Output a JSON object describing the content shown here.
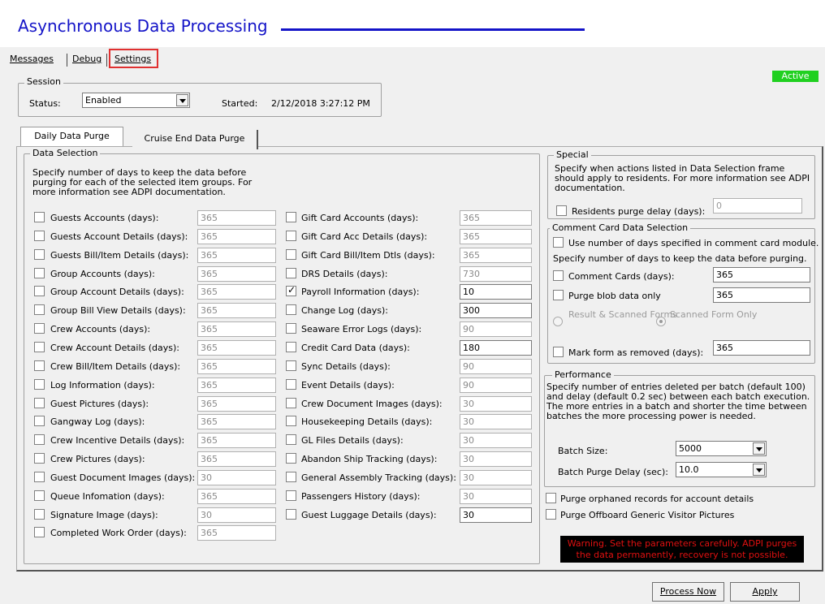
{
  "app": {
    "title": "Asynchronous Data Processing",
    "status_badge": "Active"
  },
  "menu": {
    "messages": "Messages",
    "debug": "Debug",
    "settings": "Settings"
  },
  "session": {
    "label": "Session",
    "status_label": "Status:",
    "status_value": "Enabled",
    "started_label": "Started:",
    "started_value": "2/12/2018 3:27:12 PM"
  },
  "tabs": {
    "daily": "Daily Data Purge",
    "cruise": "Cruise End Data Purge"
  },
  "data_selection": {
    "label": "Data Selection",
    "description": "Specify number of days to keep the data before purging for each of the selected item groups. For more information see ADPI documentation.",
    "col1": [
      {
        "label": "Guests Accounts (days):",
        "value": "365",
        "checked": false
      },
      {
        "label": "Guests Account Details (days):",
        "value": "365",
        "checked": false
      },
      {
        "label": "Guests Bill/Item Details (days):",
        "value": "365",
        "checked": false
      },
      {
        "label": "Group Accounts (days):",
        "value": "365",
        "checked": false
      },
      {
        "label": "Group Account Details (days):",
        "value": "365",
        "checked": false
      },
      {
        "label": "Group Bill View Details (days):",
        "value": "365",
        "checked": false
      },
      {
        "label": "Crew Accounts (days):",
        "value": "365",
        "checked": false
      },
      {
        "label": "Crew Account Details (days):",
        "value": "365",
        "checked": false
      },
      {
        "label": "Crew Bill/Item Details (days):",
        "value": "365",
        "checked": false
      },
      {
        "label": "Log Information (days):",
        "value": "365",
        "checked": false
      },
      {
        "label": "Guest Pictures (days):",
        "value": "365",
        "checked": false
      },
      {
        "label": "Gangway Log (days):",
        "value": "365",
        "checked": false
      },
      {
        "label": "Crew Incentive Details (days):",
        "value": "365",
        "checked": false
      },
      {
        "label": "Crew Pictures (days):",
        "value": "365",
        "checked": false
      },
      {
        "label": "Guest Document Images (days):",
        "value": "30",
        "checked": false
      },
      {
        "label": "Queue Infomation (days):",
        "value": "365",
        "checked": false
      },
      {
        "label": "Signature Image (days):",
        "value": "30",
        "checked": false
      },
      {
        "label": "Completed Work Order (days):",
        "value": "365",
        "checked": false
      }
    ],
    "col2": [
      {
        "label": "Gift Card Accounts (days):",
        "value": "365",
        "checked": false
      },
      {
        "label": "Gift Card Acc Details (days):",
        "value": "365",
        "checked": false
      },
      {
        "label": "Gift Card Bill/Item Dtls (days):",
        "value": "365",
        "checked": false
      },
      {
        "label": "DRS Details (days):",
        "value": "730",
        "checked": false
      },
      {
        "label": "Payroll Information (days):",
        "value": "10",
        "checked": true
      },
      {
        "label": "Change Log (days):",
        "value": "300",
        "checked": false
      },
      {
        "label": "Seaware Error Logs (days):",
        "value": "90",
        "checked": false
      },
      {
        "label": "Credit Card Data (days):",
        "value": "180",
        "checked": false
      },
      {
        "label": "Sync Details (days):",
        "value": "90",
        "checked": false
      },
      {
        "label": "Event Details (days):",
        "value": "90",
        "checked": false
      },
      {
        "label": "Crew Document Images (days):",
        "value": "30",
        "checked": false
      },
      {
        "label": "Housekeeping Details (days):",
        "value": "30",
        "checked": false
      },
      {
        "label": "GL Files Details (days):",
        "value": "30",
        "checked": false
      },
      {
        "label": "Abandon Ship Tracking (days):",
        "value": "30",
        "checked": false
      },
      {
        "label": "General Assembly Tracking (days):",
        "value": "30",
        "checked": false
      },
      {
        "label": "Passengers History (days):",
        "value": "30",
        "checked": false
      },
      {
        "label": "Guest Luggage Details (days):",
        "value": "30",
        "checked": false
      }
    ]
  },
  "special": {
    "label": "Special",
    "description": "Specify when actions listed in Data Selection frame should apply to residents. For more information see ADPI documentation.",
    "residents_label": "Residents purge delay (days):",
    "residents_value": "0"
  },
  "comment_card": {
    "label": "Comment Card Data Selection",
    "use_days_label": "Use number of days specified in comment card module.",
    "specify_label": "Specify number of days to keep the data before purging.",
    "comment_cards_label": "Comment Cards (days):",
    "comment_cards_value": "365",
    "purge_blob_label": "Purge blob data only",
    "purge_blob_value": "365",
    "radio1": "Result & Scanned Forms",
    "radio2": "Scanned Form Only",
    "mark_removed_label": "Mark form as removed (days):",
    "mark_removed_value": "365"
  },
  "performance": {
    "label": "Performance",
    "description": "Specify number of entries deleted per batch (default 100) and delay (default 0.2 sec) between each batch execution. The more entries in a batch and shorter the time between batches the more processing power is needed.",
    "batch_size_label": "Batch Size:",
    "batch_size_value": "5000",
    "batch_delay_label": "Batch Purge Delay (sec):",
    "batch_delay_value": "10.0"
  },
  "options": {
    "orphaned": "Purge orphaned records for account details",
    "offboard": "Purge Offboard Generic Visitor Pictures"
  },
  "warning": "Warning. Set the parameters carefully. ADPI purges the data permanently, recovery is not possible.",
  "buttons": {
    "process_now": "Process Now",
    "apply": "Apply"
  },
  "colors": {
    "title": "#1414c8",
    "active": "#20d020",
    "warning_bg": "#000000",
    "warning_text": "#e01010"
  }
}
